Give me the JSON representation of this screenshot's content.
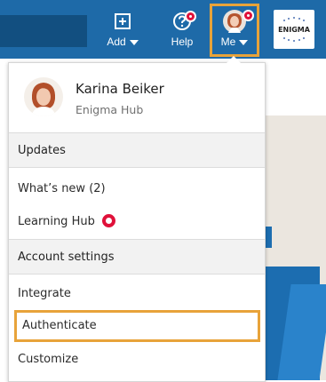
{
  "topbar": {
    "add_label": "Add",
    "help_label": "Help",
    "me_label": "Me",
    "logo_text": "ENIGMA"
  },
  "profile": {
    "name": "Karina Beiker",
    "org": "Enigma Hub"
  },
  "menu": {
    "updates_header": "Updates",
    "whats_new": "What’s new (2)",
    "learning_hub": "Learning Hub",
    "account_header": "Account settings",
    "integrate": "Integrate",
    "authenticate": "Authenticate",
    "customize": "Customize"
  },
  "colors": {
    "topbar": "#1e6aa8",
    "highlight": "#e8a33a",
    "notification": "#e0113a"
  }
}
